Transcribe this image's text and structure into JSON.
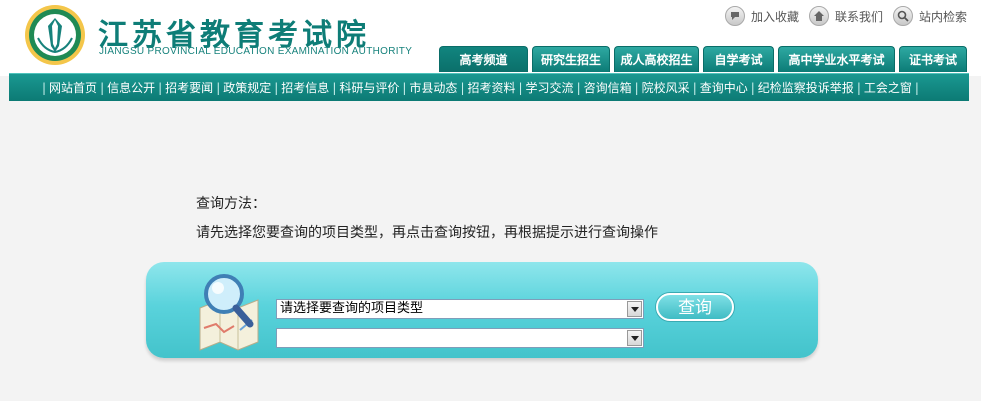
{
  "site": {
    "name_cn": "江苏省教育考试院",
    "name_en": "JIANGSU PROVINCIAL EDUCATION EXAMINATION AUTHORITY"
  },
  "toplinks": [
    {
      "label": "加入收藏",
      "icon": "bookmark-icon"
    },
    {
      "label": "联系我们",
      "icon": "home-icon"
    },
    {
      "label": "站内检索",
      "icon": "search-icon"
    }
  ],
  "tabs": [
    "高考频道",
    "研究生招生",
    "成人高校招生",
    "自学考试",
    "高中学业水平考试",
    "证书考试"
  ],
  "nav": [
    "网站首页",
    "信息公开",
    "招考要闻",
    "政策规定",
    "招考信息",
    "科研与评价",
    "市县动态",
    "招考资料",
    "学习交流",
    "咨询信箱",
    "院校风采",
    "查询中心",
    "纪检监察投诉举报",
    "工会之窗"
  ],
  "query": {
    "method_title": "查询方法：",
    "method_desc": "请先选择您要查询的项目类型，再点击查询按钮，再根据提示进行查询操作",
    "select1_value": "请选择要查询的项目类型",
    "select2_value": "",
    "button_label": "查询"
  },
  "colors": {
    "brand": "#0e7d77",
    "panel": "#5ad3dc",
    "background": "#f3f3f3"
  }
}
